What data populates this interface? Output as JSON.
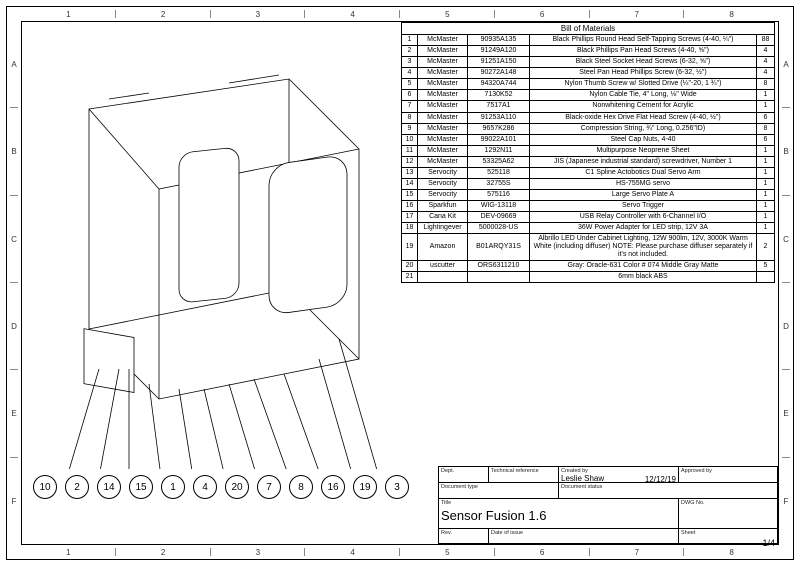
{
  "ruler": {
    "cols": [
      "1",
      "2",
      "3",
      "4",
      "5",
      "6",
      "7",
      "8"
    ],
    "rows": [
      "A",
      "B",
      "C",
      "D",
      "E",
      "F"
    ]
  },
  "bom": {
    "title": "Bill of Materials",
    "rows": [
      {
        "item": "1",
        "vendor": "McMaster",
        "part": "90935A135",
        "desc": "Black Phillips Round Head Self-Tapping Screws (4-40, ¼\")",
        "qty": "88"
      },
      {
        "item": "2",
        "vendor": "McMaster",
        "part": "91249A120",
        "desc": "Black Phillips Pan Head Screws (4-40, ⅝\")",
        "qty": "4"
      },
      {
        "item": "3",
        "vendor": "McMaster",
        "part": "91251A150",
        "desc": "Black Steel Socket Head Screws (6-32, ⅝\")",
        "qty": "4"
      },
      {
        "item": "4",
        "vendor": "McMaster",
        "part": "90272A148",
        "desc": "Steel Pan Head Phillips Screw (6-32, ½\")",
        "qty": "4"
      },
      {
        "item": "5",
        "vendor": "McMaster",
        "part": "94320A744",
        "desc": "Nylon Thumb Screw w/ Slotted Drive (¼\"-20, 1 ¾\")",
        "qty": "8"
      },
      {
        "item": "6",
        "vendor": "McMaster",
        "part": "7130K52",
        "desc": "Nylon Cable Tie, 4\" Long, ⅛\" Wide",
        "qty": "1"
      },
      {
        "item": "7",
        "vendor": "McMaster",
        "part": "7517A1",
        "desc": "Nonwhitening Cement for Acrylic",
        "qty": "1"
      },
      {
        "item": "8",
        "vendor": "McMaster",
        "part": "91253A110",
        "desc": "Black-oxide Hex Drive Flat Head Screw (4-40, ½\")",
        "qty": "6"
      },
      {
        "item": "9",
        "vendor": "McMaster",
        "part": "9657K286",
        "desc": "Compression String, ¾\" Long, 0.256\"ID)",
        "qty": "8"
      },
      {
        "item": "10",
        "vendor": "McMaster",
        "part": "99022A101",
        "desc": "Steel Cap Nuts, 4-40",
        "qty": "6"
      },
      {
        "item": "11",
        "vendor": "McMaster",
        "part": "1292N11",
        "desc": "Multipurpose Neoprene Sheet",
        "qty": "1"
      },
      {
        "item": "12",
        "vendor": "McMaster",
        "part": "53325A62",
        "desc": "JIS (Japanese industrial standard) screwdriver, Number 1",
        "qty": "1"
      },
      {
        "item": "13",
        "vendor": "Servocity",
        "part": "525118",
        "desc": "C1 Spline Actobotics Dual Servo Arm",
        "qty": "1"
      },
      {
        "item": "14",
        "vendor": "Servocity",
        "part": "32755S",
        "desc": "HS-755MG servo",
        "qty": "1"
      },
      {
        "item": "15",
        "vendor": "Servocity",
        "part": "575116",
        "desc": "Large Servo Plate A",
        "qty": "1"
      },
      {
        "item": "16",
        "vendor": "Sparkfun",
        "part": "WIG-13118",
        "desc": "Servo Trigger",
        "qty": "1"
      },
      {
        "item": "17",
        "vendor": "Cana Kit",
        "part": "DEV-09669",
        "desc": "USB Relay Controller with 6-Channel I/O",
        "qty": "1"
      },
      {
        "item": "18",
        "vendor": "Lightingever",
        "part": "5000028-US",
        "desc": "36W Power Adapter for LED strip, 12V 3A",
        "qty": "1"
      },
      {
        "item": "19",
        "vendor": "Amazon",
        "part": "B01ARQY31S",
        "desc": "Albrillo LED Under Cabinet Lighting, 12W 900lm, 12V, 3000K Warm White (including diffuser) NOTE: Please purchase diffuser separately if it's not included.",
        "qty": "2"
      },
      {
        "item": "20",
        "vendor": "uscutter",
        "part": "ORS6311210",
        "desc": "Gray: Oracle-631 Color # 074 Middle Gray Matte",
        "qty": "5"
      },
      {
        "item": "21",
        "vendor": "",
        "part": "",
        "desc": "6mm black ABS",
        "qty": ""
      }
    ]
  },
  "balloons": [
    "10",
    "2",
    "14",
    "15",
    "1",
    "4",
    "20",
    "7",
    "8",
    "16",
    "19",
    "3"
  ],
  "titleblock": {
    "labels": {
      "dept": "Dept.",
      "techref": "Technical reference",
      "created": "Created by",
      "approved": "Approved by",
      "doctype": "Document type",
      "docstatus": "Document status",
      "title": "Title",
      "dwgno": "DWG No.",
      "rev": "Rev.",
      "dateissue": "Date of issue",
      "sheet": "Sheet"
    },
    "created_by": "Leslie Shaw",
    "created_date": "12/12/19",
    "title": "Sensor Fusion 1.6",
    "sheet": "1/4"
  }
}
